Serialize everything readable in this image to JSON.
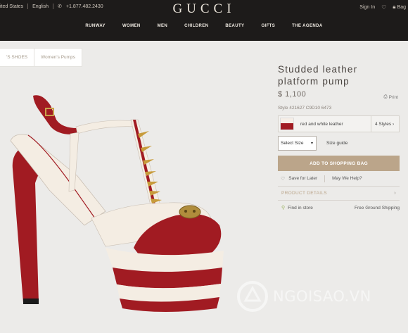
{
  "header": {
    "country": "ited States",
    "language": "English",
    "phone": "+1.877.482.2430",
    "logo": "GUCCI",
    "sign_in": "Sign In",
    "bag": "Bag",
    "nav": [
      "RUNWAY",
      "WOMEN",
      "MEN",
      "CHILDREN",
      "BEAUTY",
      "GIFTS",
      "THE AGENDA"
    ]
  },
  "breadcrumb": [
    "'S SHOES",
    "Women's Pumps"
  ],
  "product": {
    "title_line1": "Studded leather",
    "title_line2": "platform pump",
    "price": "$ 1,100",
    "print": "Print",
    "style_number": "Style 421627 C9D10 6473",
    "color_name": "red and white leather",
    "styles_count": "4 Styles",
    "size_placeholder": "Select Size",
    "size_guide": "Size guide",
    "add_to_bag": "ADD TO SHOPPING BAG",
    "save_for_later": "Save for Later",
    "may_we_help": "May We Help?",
    "product_details": "PRODUCT DETAILS",
    "find_in_store": "Find in store",
    "shipping": "Free Ground Shipping"
  },
  "watermark": "NGOISAO.VN",
  "colors": {
    "header_bg": "#1d1b1a",
    "accent": "#bba58a",
    "shoe_red": "#a11b22",
    "shoe_cream": "#f4ede3"
  },
  "icons": [
    "phone-icon",
    "heart-icon",
    "bag-icon",
    "print-icon",
    "chevron-down-icon",
    "chevron-right-icon",
    "location-pin-icon"
  ]
}
